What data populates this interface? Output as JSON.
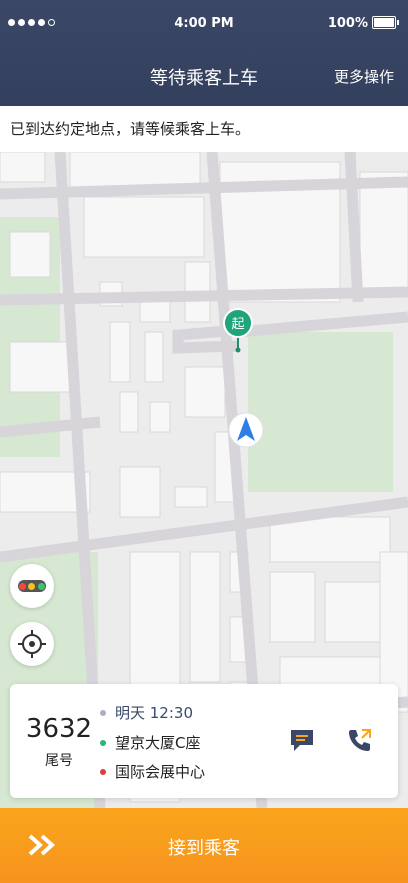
{
  "status_bar": {
    "time": "4:00 PM",
    "battery": "100%"
  },
  "nav": {
    "title": "等待乘客上车",
    "more": "更多操作"
  },
  "notice": "已到达约定地点，请等候乘客上车。",
  "map": {
    "start_marker_label": "起"
  },
  "trip": {
    "tail_number": "3632",
    "tail_label": "尾号",
    "time": "明天 12:30",
    "start": "望京大厦C座",
    "destination": "国际会展中心"
  },
  "bottom_bar": {
    "action": "接到乘客"
  },
  "colors": {
    "header": "#3b4766",
    "accent": "#f9a51c",
    "start_dot": "#2bb673",
    "end_dot": "#e03a3a",
    "time_dot": "#a9b0bf",
    "map_green": "#d6e8d2",
    "marker_green": "#1fa579",
    "nav_arrow": "#2f7ee6"
  },
  "icons": {
    "message": "message-icon",
    "call": "phone-call-icon",
    "locate": "locate-icon",
    "traffic": "traffic-light-icon",
    "pass": "double-chevron-icon"
  }
}
